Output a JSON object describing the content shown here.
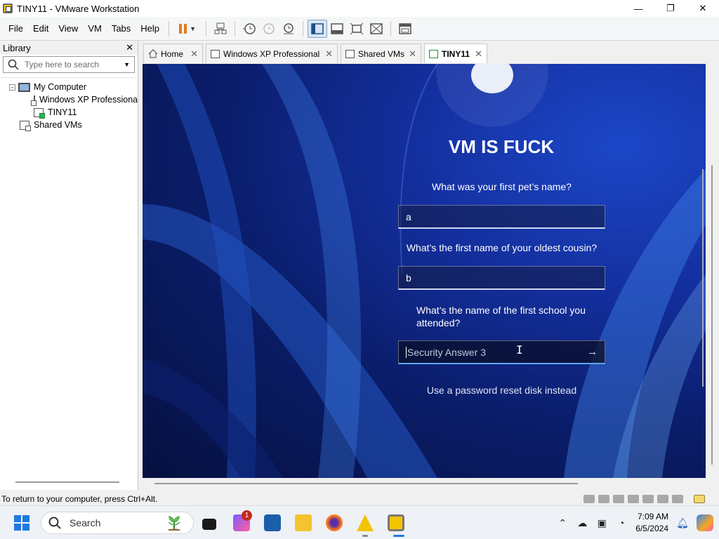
{
  "window": {
    "title": "TINY11 - VMware Workstation",
    "minimize": "—",
    "maximize": "❐",
    "close": "✕"
  },
  "menu": [
    "File",
    "Edit",
    "View",
    "VM",
    "Tabs",
    "Help"
  ],
  "library": {
    "title": "Library",
    "close": "✕",
    "search_placeholder": "Type here to search",
    "tree": {
      "root_toggle": "−",
      "root": "My Computer",
      "children": [
        "Windows XP Professional",
        "TINY11"
      ],
      "shared": "Shared VMs"
    }
  },
  "tabs": [
    {
      "label": "Home",
      "close": "✕"
    },
    {
      "label": "Windows XP Professional",
      "close": "✕"
    },
    {
      "label": "Shared VMs",
      "close": "✕"
    },
    {
      "label": "TINY11",
      "close": "✕"
    }
  ],
  "vm": {
    "user_name": "VM IS FUCK",
    "questions": [
      {
        "label": "What was your first pet’s name?",
        "answer": "a"
      },
      {
        "label": "What’s the first name of your oldest cousin?",
        "answer": "b"
      },
      {
        "label": "What’s the name of the first school you attended?",
        "answer": "",
        "placeholder": "Security Answer 3"
      }
    ],
    "submit_arrow": "→",
    "reset_link": "Use a password reset disk instead"
  },
  "status": {
    "message": "To return to your computer, press Ctrl+Alt."
  },
  "taskbar": {
    "search_placeholder": "Search",
    "notification_badge": "1",
    "clock_time": "7:09 AM",
    "clock_date": "6/5/2024"
  },
  "colors": {
    "accent": "#1f7ae0",
    "vm_background": "#1430a0",
    "pause_orange": "#e07c1c"
  }
}
